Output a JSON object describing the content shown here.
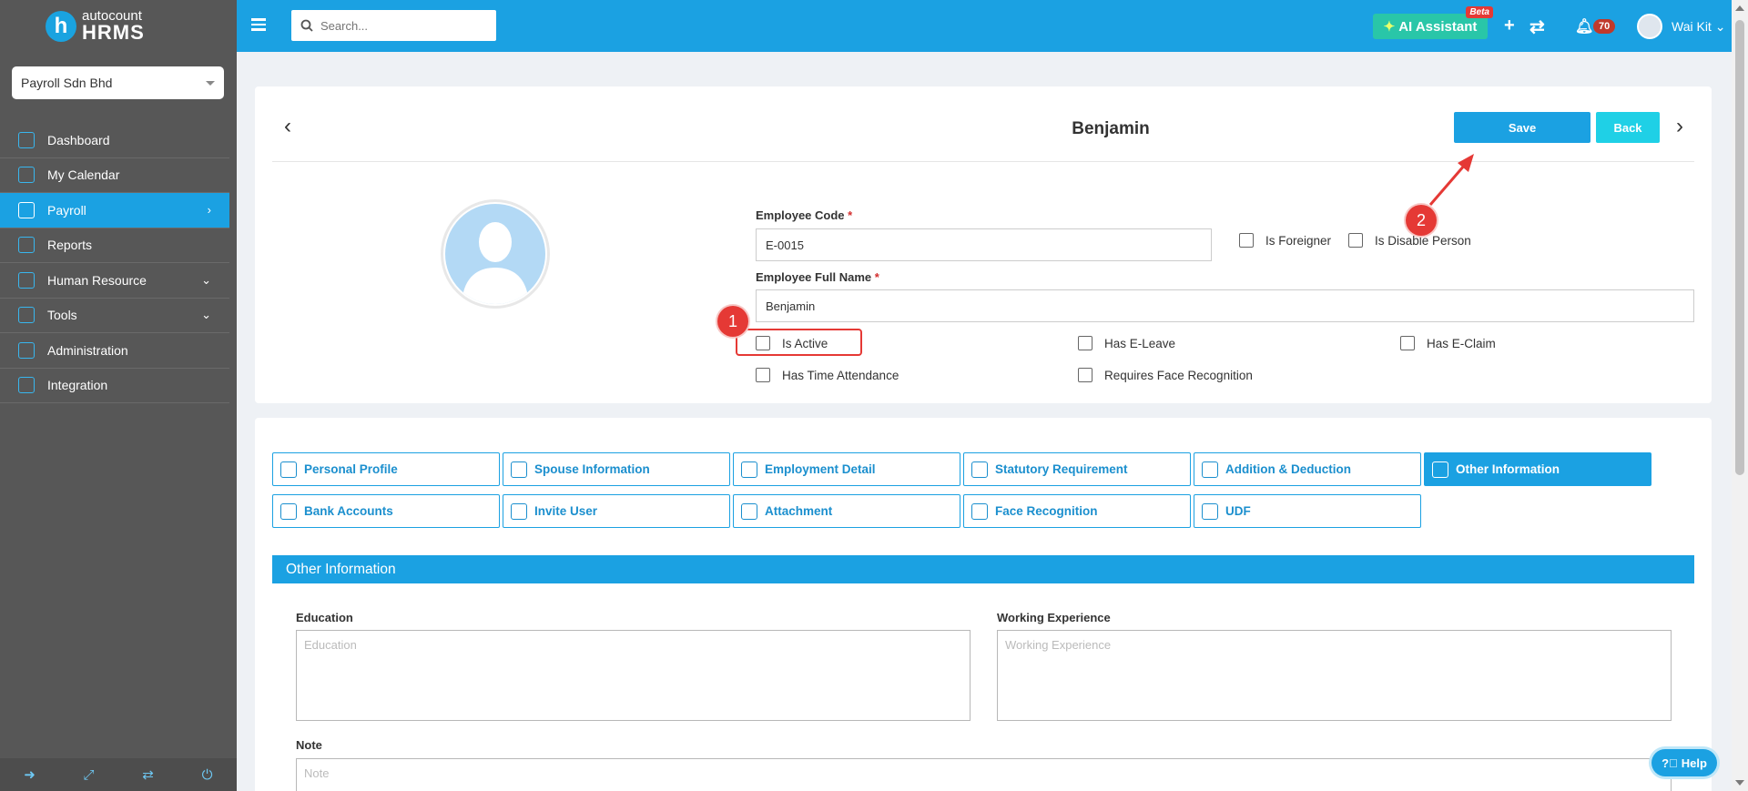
{
  "brand": {
    "top": "autocount",
    "bottom": "HRMS",
    "logo_letter": "h"
  },
  "company": {
    "selected": "Payroll Sdn Bhd"
  },
  "sidebar": {
    "items": [
      {
        "label": "Dashboard",
        "icon": "dashboard-icon"
      },
      {
        "label": "My Calendar",
        "icon": "calendar-icon"
      },
      {
        "label": "Payroll",
        "icon": "payroll-icon",
        "active": true,
        "chevron": "›"
      },
      {
        "label": "Reports",
        "icon": "reports-icon"
      },
      {
        "label": "Human Resource",
        "icon": "people-icon",
        "chevron": "⌄"
      },
      {
        "label": "Tools",
        "icon": "tools-icon",
        "chevron": "⌄"
      },
      {
        "label": "Administration",
        "icon": "admin-icon"
      },
      {
        "label": "Integration",
        "icon": "integration-icon"
      }
    ]
  },
  "header": {
    "search_placeholder": "Search...",
    "ai_label": "AI Assistant",
    "beta": "Beta",
    "notifications": "70",
    "user": "Wai Kit ⌄"
  },
  "record": {
    "title": "Benjamin",
    "save_label": "Save",
    "back_label": "Back"
  },
  "form": {
    "code_label": "Employee Code",
    "code_value": "E-0015",
    "name_label": "Employee Full Name",
    "name_value": "Benjamin",
    "required_mark": "*",
    "checkboxes": {
      "foreigner": "Is Foreigner",
      "disable": "Is Disable Person",
      "active": "Is Active",
      "eleave": "Has E-Leave",
      "eclaim": "Has E-Claim",
      "attendance": "Has Time Attendance",
      "face": "Requires Face Recognition"
    }
  },
  "annotations": {
    "one": "1",
    "two": "2"
  },
  "tabs": [
    {
      "label": "Personal Profile"
    },
    {
      "label": "Spouse Information"
    },
    {
      "label": "Employment Detail"
    },
    {
      "label": "Statutory Requirement"
    },
    {
      "label": "Addition & Deduction"
    },
    {
      "label": "Other Information",
      "active": true
    },
    {
      "label": "Bank Accounts"
    },
    {
      "label": "Invite User"
    },
    {
      "label": "Attachment"
    },
    {
      "label": "Face Recognition"
    },
    {
      "label": "UDF"
    }
  ],
  "other_info": {
    "title": "Other Information",
    "education_label": "Education",
    "education_placeholder": "Education",
    "experience_label": "Working Experience",
    "experience_placeholder": "Working Experience",
    "note_label": "Note",
    "note_placeholder": "Note"
  },
  "help_label": "Help",
  "colors": {
    "primary": "#1ba1e2",
    "sidebar": "#575757",
    "annotation": "#e53935",
    "ai": "#29c6a8"
  }
}
